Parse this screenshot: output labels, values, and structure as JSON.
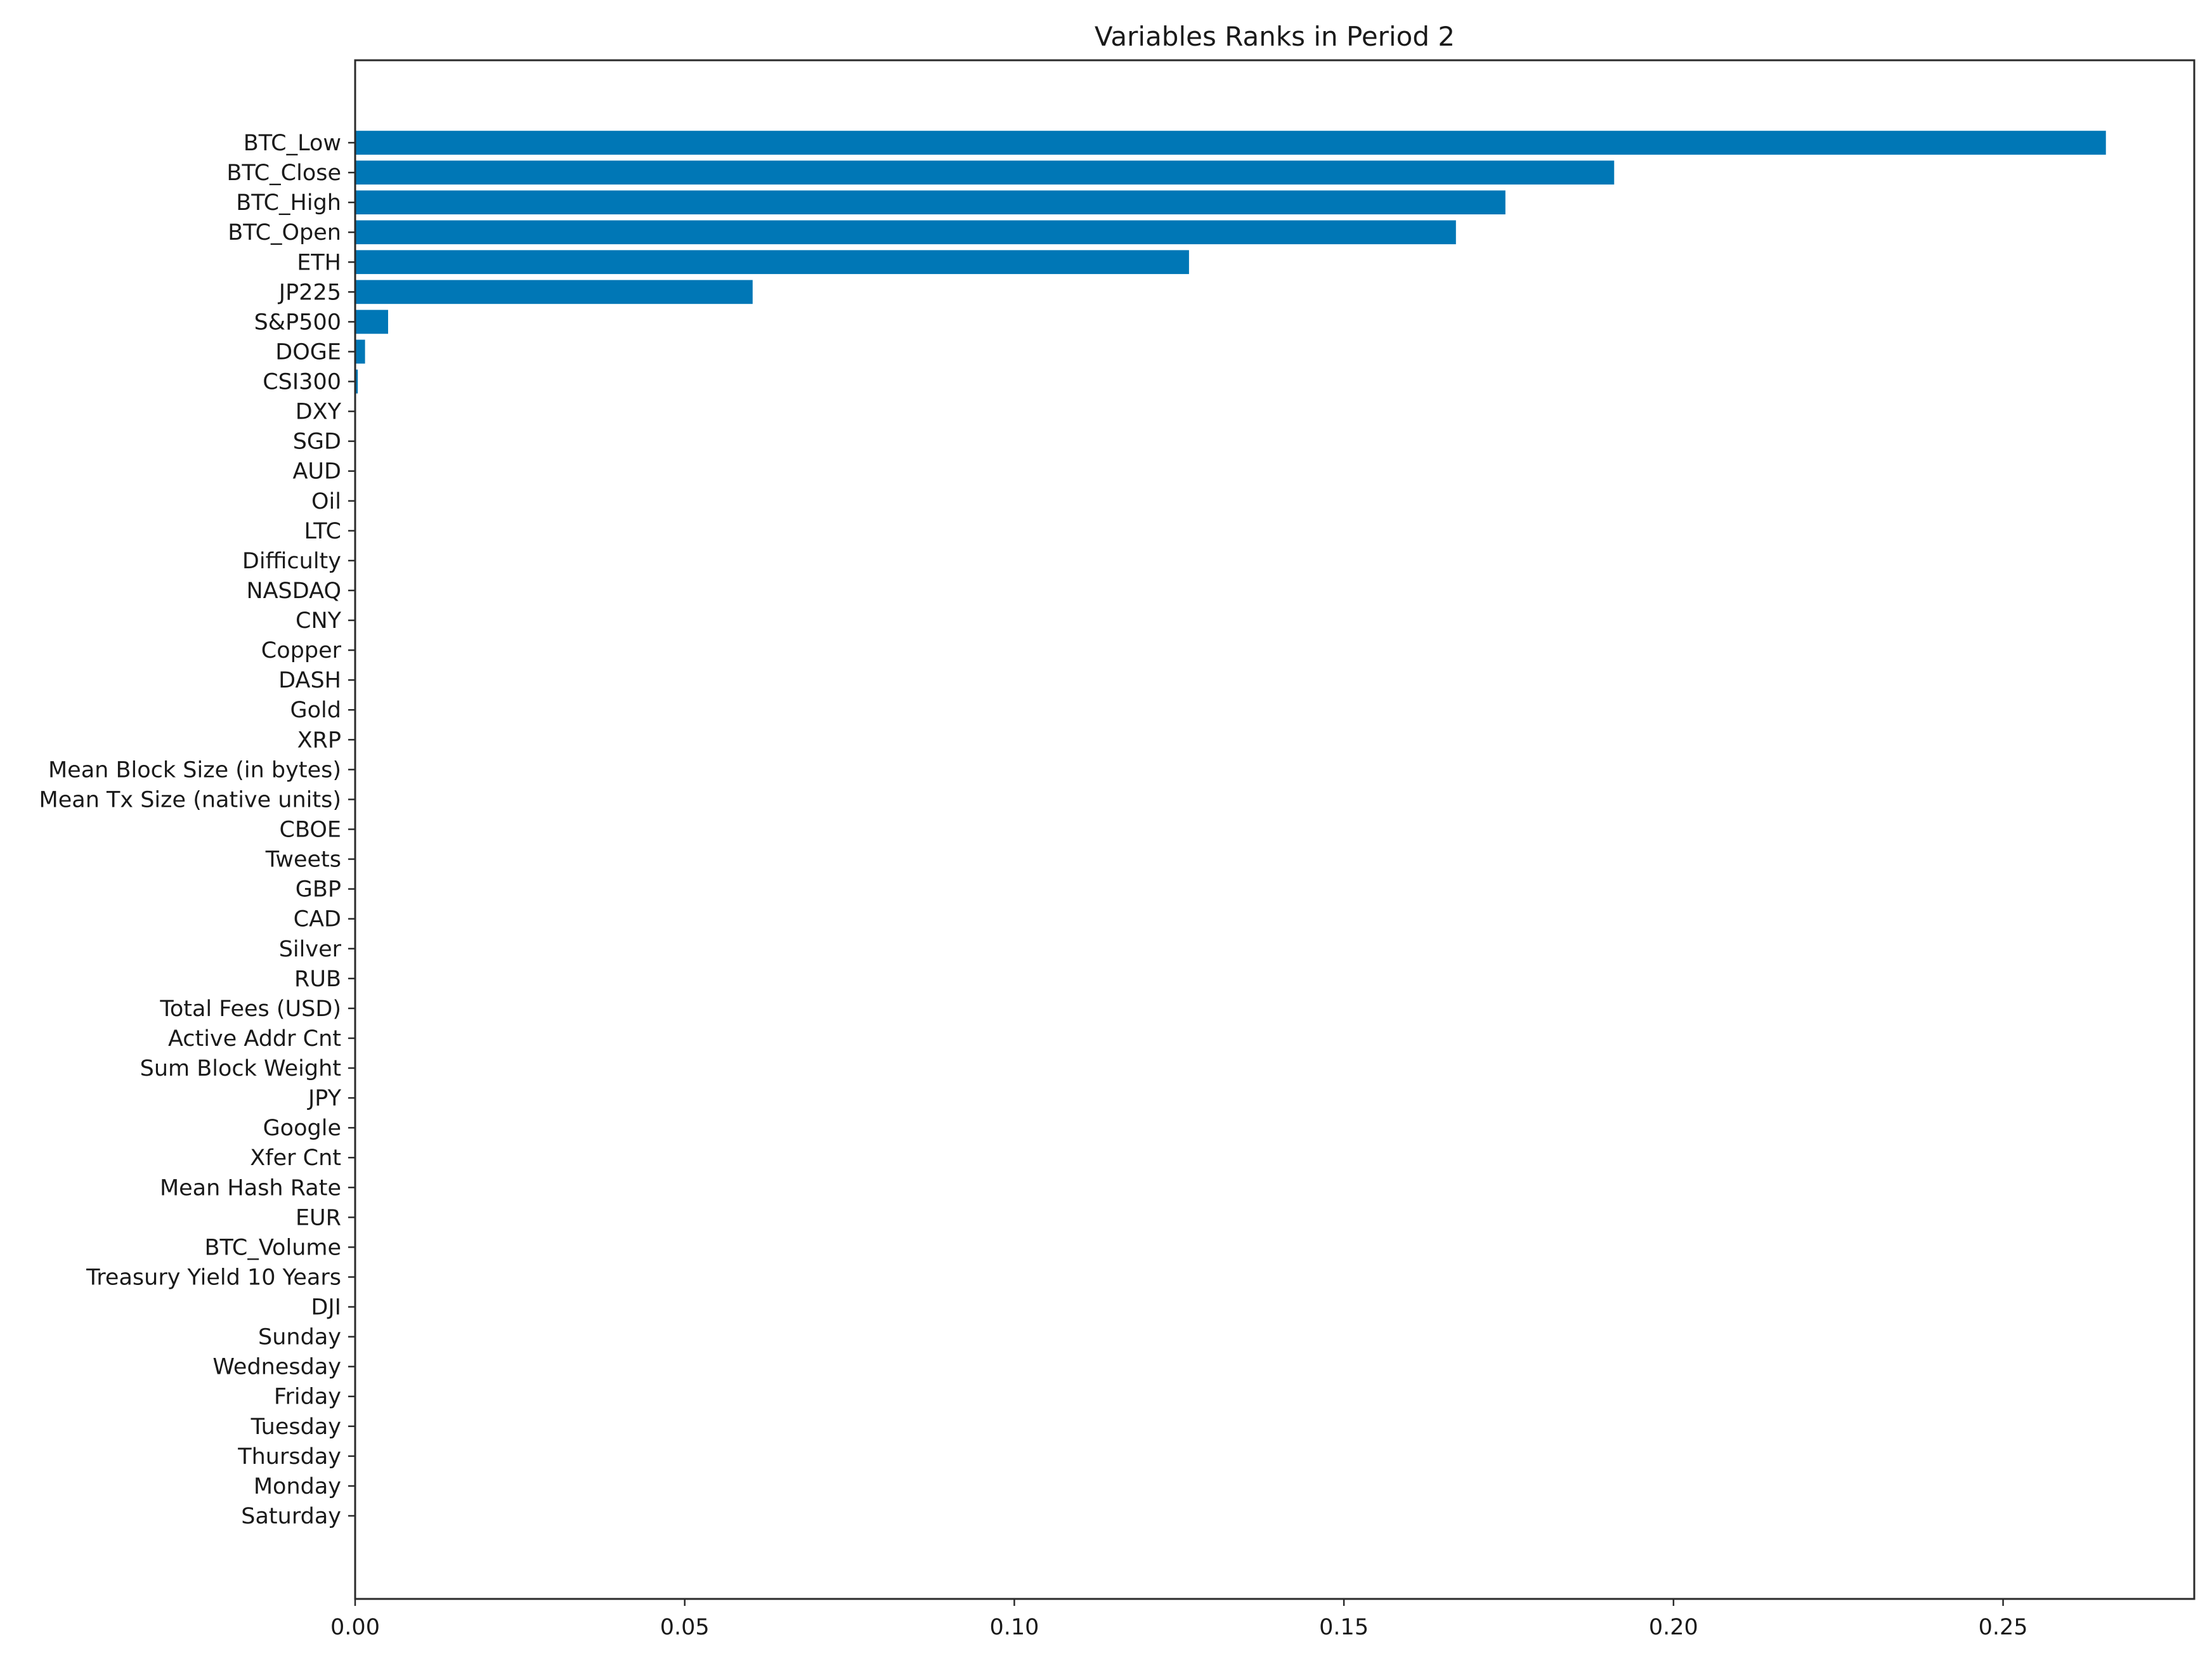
{
  "chart_data": {
    "type": "bar",
    "orientation": "horizontal",
    "title": "Variables Ranks in Period 2",
    "xlabel": "",
    "ylabel": "",
    "xlim": [
      0,
      0.279
    ],
    "xticks": [
      0.0,
      0.05,
      0.1,
      0.15,
      0.2,
      0.25
    ],
    "xtick_labels": [
      "0.00",
      "0.05",
      "0.10",
      "0.15",
      "0.20",
      "0.25"
    ],
    "grid": false,
    "legend": null,
    "bar_color": "#0077b6",
    "categories": [
      "BTC_Low",
      "BTC_Close",
      "BTC_High",
      "BTC_Open",
      "ETH",
      "JP225",
      "S&P500",
      "DOGE",
      "CSI300",
      "DXY",
      "SGD",
      "AUD",
      "Oil",
      "LTC",
      "Difficulty",
      "NASDAQ",
      "CNY",
      "Copper",
      "DASH",
      "Gold",
      "XRP",
      "Mean Block Size (in bytes)",
      "Mean Tx Size (native units)",
      "CBOE",
      "Tweets",
      "GBP",
      "CAD",
      "Silver",
      "RUB",
      "Total Fees (USD)",
      "Active Addr Cnt",
      "Sum Block Weight",
      "JPY",
      "Google",
      "Xfer Cnt",
      "Mean Hash Rate",
      "EUR",
      "BTC_Volume",
      "Treasury Yield 10 Years",
      "DJI",
      "Sunday",
      "Wednesday",
      "Friday",
      "Tuesday",
      "Thursday",
      "Monday",
      "Saturday"
    ],
    "values": [
      0.2656,
      0.191,
      0.1745,
      0.167,
      0.1265,
      0.0603,
      0.005,
      0.0015,
      0.0004,
      0.0001,
      0.0001,
      0.0001,
      0.0001,
      0.0001,
      0.0001,
      0.0001,
      0.0001,
      0.0,
      0.0,
      0.0,
      0.0,
      0.0,
      0.0,
      0.0,
      0.0,
      0.0,
      0.0,
      0.0,
      0.0,
      0.0,
      0.0,
      0.0,
      0.0,
      0.0,
      0.0,
      0.0,
      0.0,
      0.0,
      0.0,
      0.0,
      0.0,
      0.0,
      0.0,
      0.0,
      0.0,
      0.0,
      0.0
    ]
  }
}
